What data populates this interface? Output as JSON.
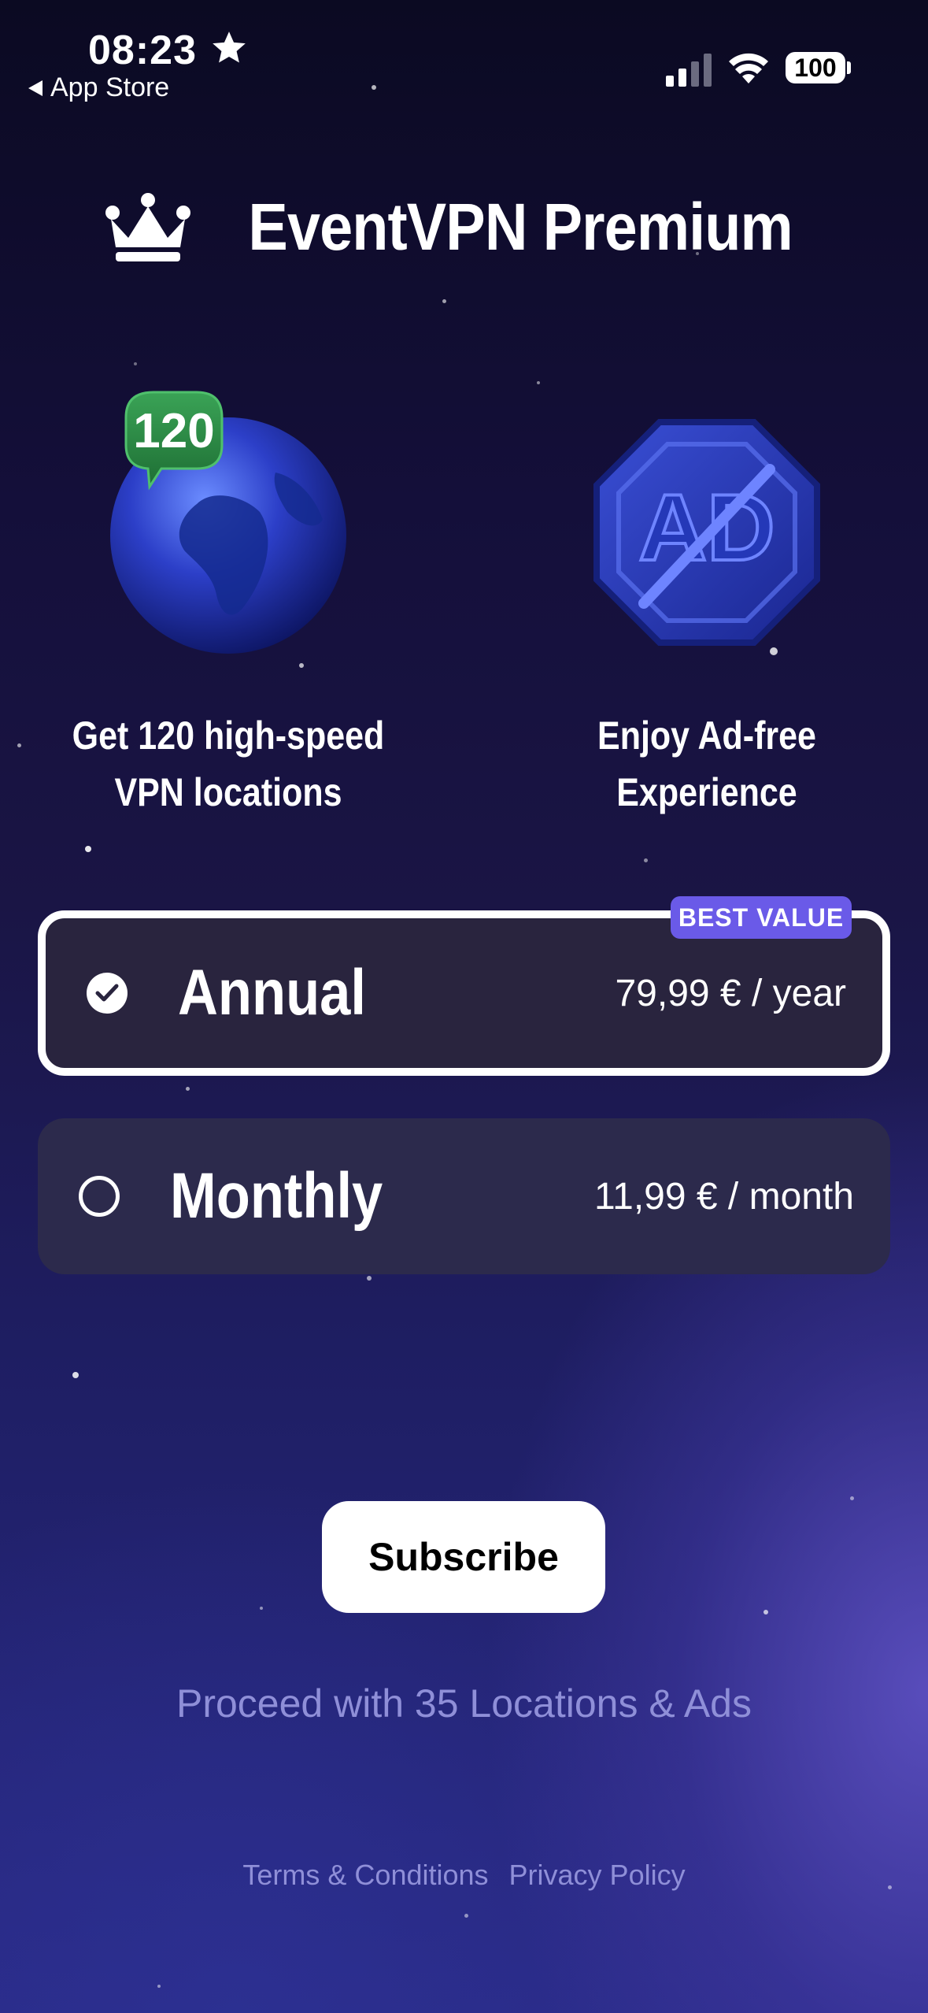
{
  "status_bar": {
    "time": "08:23",
    "back_app": "App Store",
    "battery": "100"
  },
  "header": {
    "title": "EventVPN Premium"
  },
  "features": [
    {
      "badge_number": "120",
      "line1": "Get 120 high-speed",
      "line2": "VPN locations",
      "icon": "globe-icon"
    },
    {
      "badge_text": "AD",
      "line1": "Enjoy Ad-free",
      "line2": "Experience",
      "icon": "no-ads-icon"
    }
  ],
  "plans": {
    "badge": "BEST VALUE",
    "annual": {
      "name": "Annual",
      "price": "79,99 € / year",
      "selected": true
    },
    "monthly": {
      "name": "Monthly",
      "price": "11,99 € / month",
      "selected": false
    }
  },
  "actions": {
    "subscribe_label": "Subscribe",
    "proceed_label": "Proceed with 35 Locations & Ads"
  },
  "footer": {
    "terms_label": "Terms & Conditions",
    "privacy_label": "Privacy Policy"
  },
  "colors": {
    "background_top": "#0b0a22",
    "background_bottom": "#2a2a86",
    "badge": "#6a5ae8",
    "globe_badge": "#2f8a46",
    "muted_text": "#8f8fd8"
  }
}
